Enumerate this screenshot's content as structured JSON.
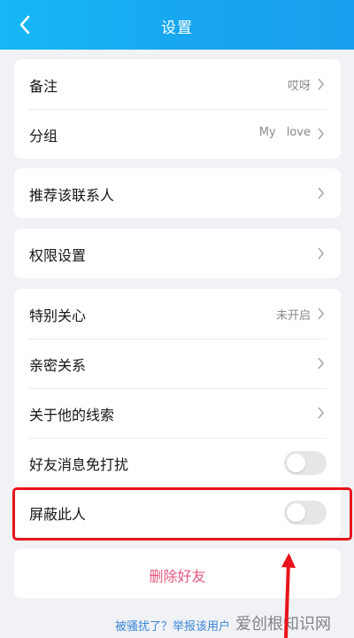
{
  "header": {
    "title": "设置"
  },
  "group1": {
    "remark": {
      "label": "备注",
      "value": "哎呀"
    },
    "group": {
      "label": "分组",
      "value": "My love"
    }
  },
  "group2": {
    "recommend": {
      "label": "推荐该联系人"
    }
  },
  "group3": {
    "permissions": {
      "label": "权限设置"
    }
  },
  "group4": {
    "special_care": {
      "label": "特别关心",
      "value": "未开启"
    },
    "intimate": {
      "label": "亲密关系"
    },
    "clues": {
      "label": "关于他的线索"
    },
    "mute": {
      "label": "好友消息免打扰",
      "enabled": false
    },
    "block": {
      "label": "屏蔽此人",
      "enabled": false
    }
  },
  "delete": {
    "label": "删除好友"
  },
  "footer": {
    "report_text": "被骚扰了？举报该用户"
  },
  "watermark": "爱创根知识网",
  "colors": {
    "header_gradient_start": "#16b8f5",
    "header_gradient_end": "#1aa0ee",
    "delete_red": "#e4597c",
    "highlight_red": "#e8141a",
    "link_blue": "#3b86d6"
  }
}
